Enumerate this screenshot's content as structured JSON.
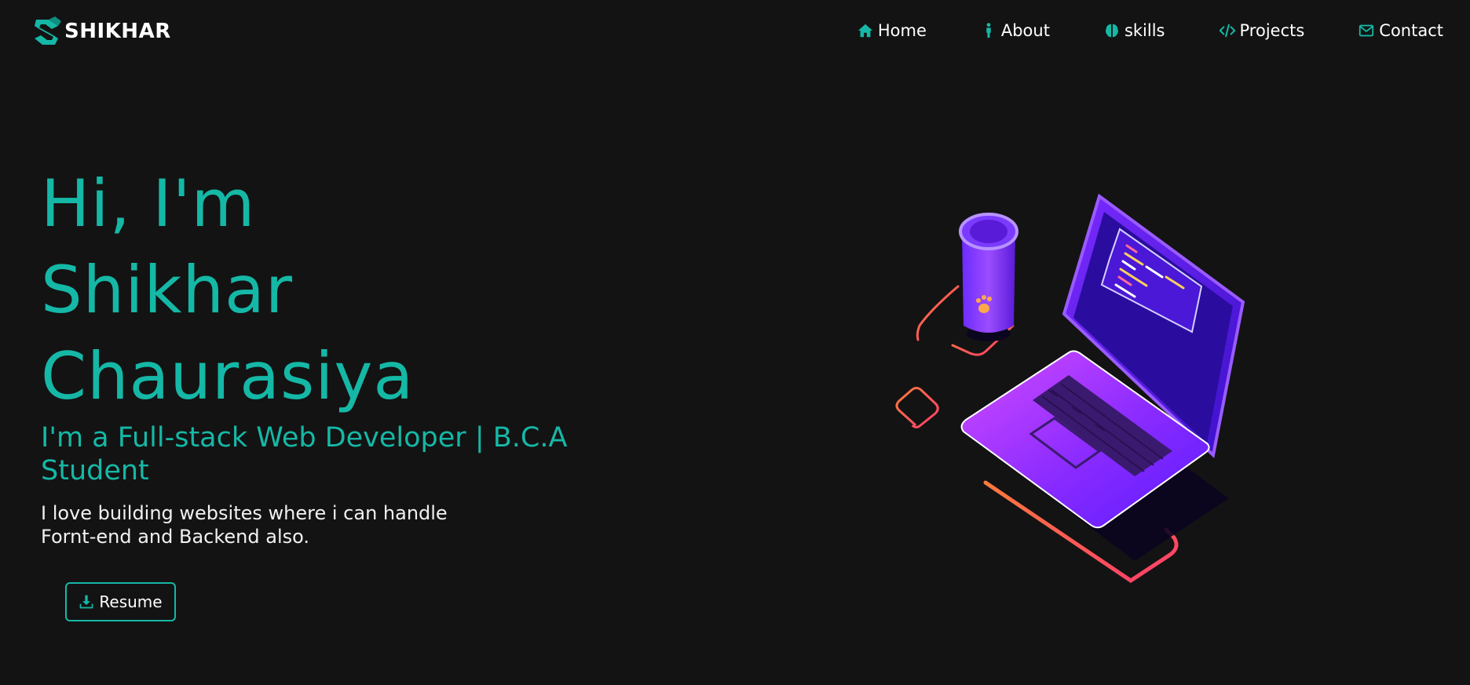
{
  "brand": {
    "name": "SHIKHAR",
    "accent": "#15b8a6",
    "background": "#131313"
  },
  "nav": {
    "items": [
      {
        "label": "Home",
        "icon": "home-icon"
      },
      {
        "label": "About",
        "icon": "person-icon"
      },
      {
        "label": "skills",
        "icon": "brain-icon"
      },
      {
        "label": "Projects",
        "icon": "code-icon"
      },
      {
        "label": "Contact",
        "icon": "envelope-icon"
      }
    ]
  },
  "hero": {
    "greeting": "Hi, I'm",
    "first_name": "Shikhar",
    "last_name": "Chaurasiya",
    "role": "I'm a Full-stack Web Developer | B.C.A Student",
    "description": "I love building websites where i can handle Fornt-end and Backend also.",
    "resume_label": "Resume",
    "resume_icon": "download-icon"
  }
}
